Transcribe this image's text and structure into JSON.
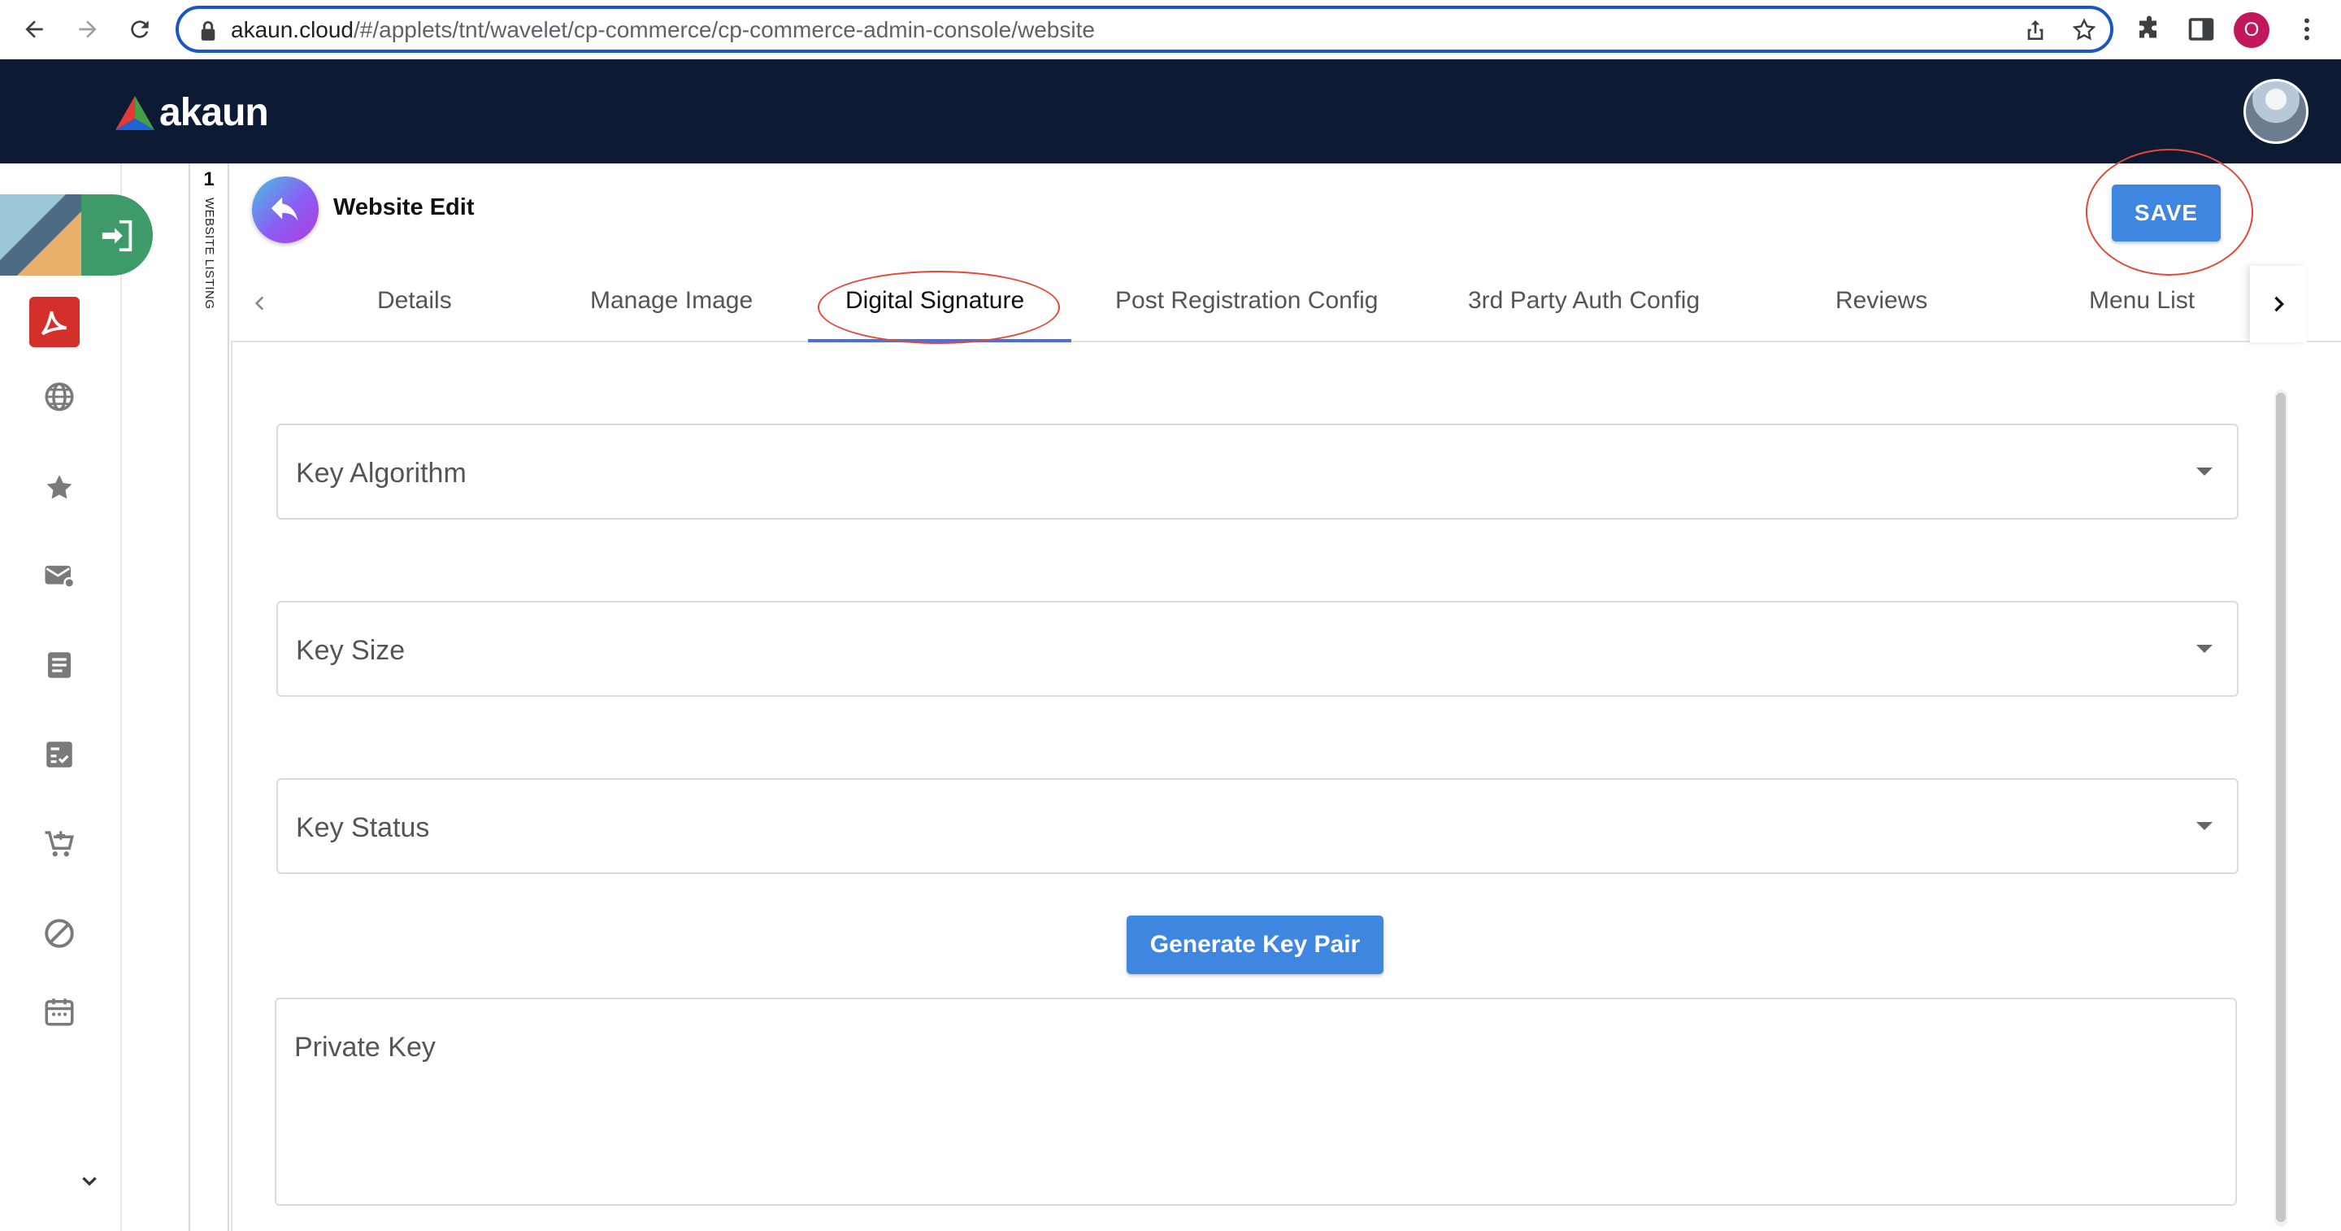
{
  "browser": {
    "url_host": "akaun.cloud",
    "url_path": "/#/applets/tnt/wavelet/cp-commerce/cp-commerce-admin-console/website",
    "profile_initial": "O"
  },
  "app": {
    "brand": "akaun"
  },
  "listing": {
    "count": "1",
    "label": "WEBSITE LISTING"
  },
  "page": {
    "title": "Website Edit",
    "save_label": "SAVE"
  },
  "tabs": [
    {
      "label": "Details"
    },
    {
      "label": "Manage Image"
    },
    {
      "label": "Digital Signature",
      "active": true
    },
    {
      "label": "Post Registration Config"
    },
    {
      "label": "3rd Party Auth Config"
    },
    {
      "label": "Reviews"
    },
    {
      "label": "Menu List"
    }
  ],
  "form": {
    "key_algorithm_label": "Key Algorithm",
    "key_size_label": "Key Size",
    "key_status_label": "Key Status",
    "generate_label": "Generate Key Pair",
    "private_key_label": "Private Key"
  },
  "colors": {
    "header_bg": "#0c1b33",
    "primary": "#3f86e0",
    "annotation": "#e0493b",
    "switcher": "#3f9a6a"
  },
  "sidebar_icons": [
    "acrobat-icon",
    "globe-icon",
    "star-icon",
    "mail-icon",
    "document-icon",
    "checklist-icon",
    "cart-icon",
    "block-icon",
    "calendar-icon"
  ]
}
